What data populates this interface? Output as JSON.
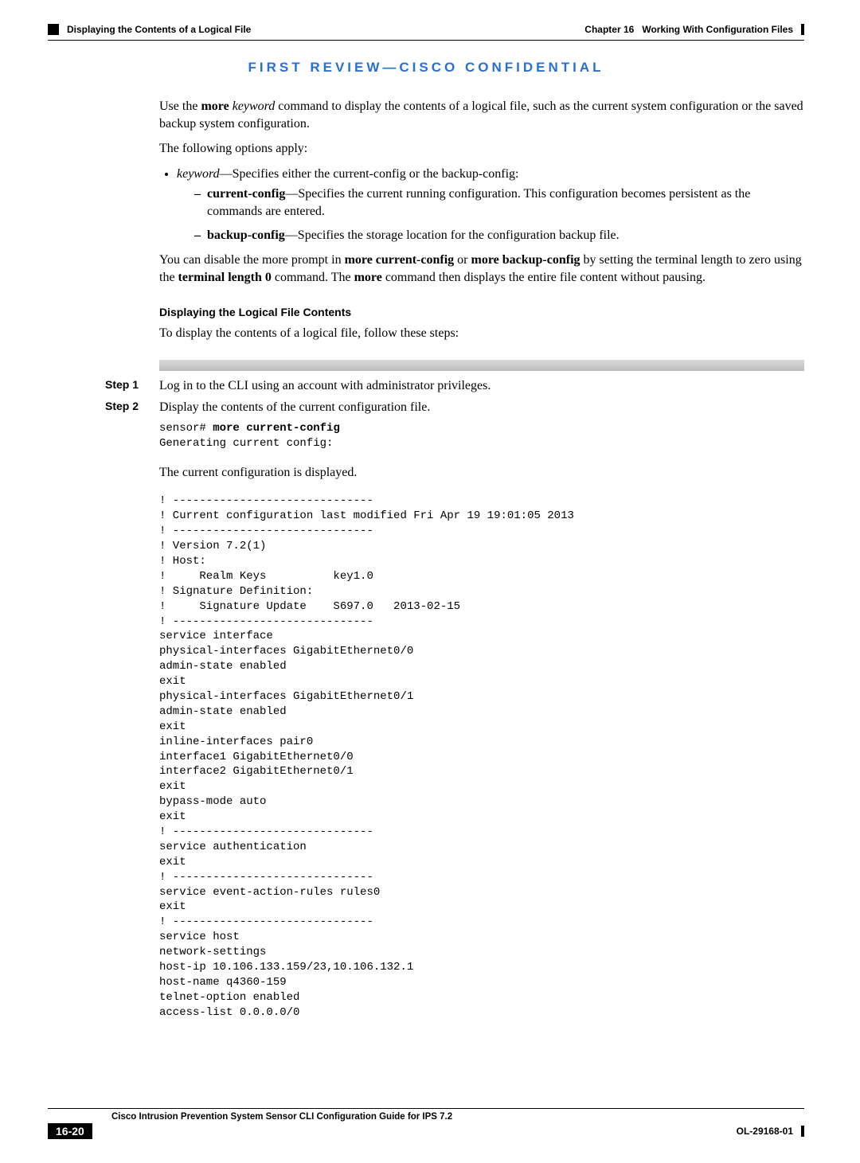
{
  "header": {
    "chapter_label": "Chapter 16",
    "chapter_title": "Working With Configuration Files",
    "section_title": "Displaying the Contents of a Logical File"
  },
  "banner": "FIRST REVIEW—CISCO CONFIDENTIAL",
  "intro1_prefix": "Use the ",
  "intro1_bold": "more",
  "intro1_ital": " keyword",
  "intro1_rest": " command to display the contents of a logical file, such as the current system configuration or the saved backup system configuration.",
  "intro2": "The following options apply:",
  "bullet1_ital": "keyword",
  "bullet1_text": "—Specifies either the current-config or the backup-config:",
  "sub1_bold": "current-config",
  "sub1_text": "—Specifies the current running configuration. This configuration becomes persistent as the commands are entered.",
  "sub2_bold": "backup-config",
  "sub2_text": "—Specifies the storage location for the configuration backup file.",
  "para2_a": "You can disable the more prompt in ",
  "para2_b1": "more current-config",
  "para2_or": " or ",
  "para2_b2": "more backup-config",
  "para2_c": " by setting the terminal length to zero using the ",
  "para2_b3": "terminal length 0",
  "para2_d": " command. The ",
  "para2_b4": "more",
  "para2_e": " command then displays the entire file content without pausing.",
  "subhead": "Displaying the Logical File Contents",
  "subhead_desc": "To display the contents of a logical file, follow these steps:",
  "steps": {
    "s1_label": "Step 1",
    "s1_text": "Log in to the CLI using an account with administrator privileges.",
    "s2_label": "Step 2",
    "s2_text": "Display the contents of the current configuration file."
  },
  "code1_prompt": "sensor# ",
  "code1_cmd": "more current-config",
  "code1_out": "Generating current config: ",
  "para3": "The current configuration is displayed.",
  "config_output": "! ------------------------------\n! Current configuration last modified Fri Apr 19 19:01:05 2013\n! ------------------------------\n! Version 7.2(1)\n! Host:\n!     Realm Keys          key1.0\n! Signature Definition:\n!     Signature Update    S697.0   2013-02-15\n! ------------------------------\nservice interface\nphysical-interfaces GigabitEthernet0/0\nadmin-state enabled\nexit\nphysical-interfaces GigabitEthernet0/1\nadmin-state enabled\nexit\ninline-interfaces pair0\ninterface1 GigabitEthernet0/0\ninterface2 GigabitEthernet0/1\nexit\nbypass-mode auto\nexit\n! ------------------------------\nservice authentication\nexit\n! ------------------------------\nservice event-action-rules rules0\nexit\n! ------------------------------\nservice host\nnetwork-settings\nhost-ip 10.106.133.159/23,10.106.132.1\nhost-name q4360-159\ntelnet-option enabled\naccess-list 0.0.0.0/0",
  "footer": {
    "guide_title": "Cisco Intrusion Prevention System Sensor CLI Configuration Guide for IPS 7.2",
    "page_num": "16-20",
    "doc_num": "OL-29168-01"
  }
}
